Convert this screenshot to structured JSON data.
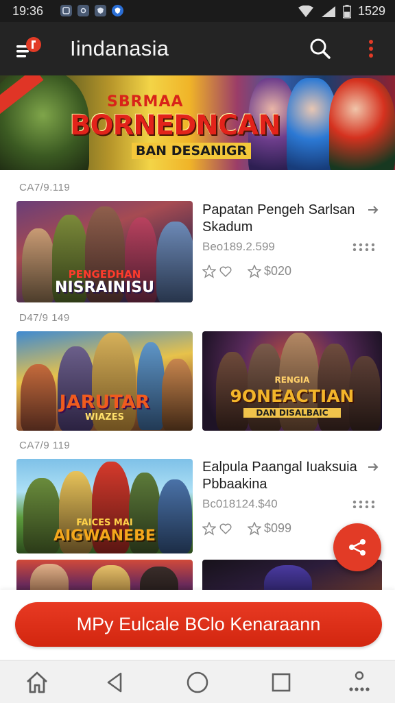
{
  "status_bar": {
    "time": "19:36",
    "clock_right": "1529",
    "icons": [
      "notification-icon",
      "photo-icon",
      "shield-icon",
      "wifi-icon",
      "signal-icon",
      "battery-icon"
    ]
  },
  "app_bar": {
    "title": "Iindanasia",
    "icons": [
      "app-logo-icon",
      "search-icon",
      "more-vert-icon"
    ]
  },
  "banner": {
    "line1": "SBRMAA",
    "line2": "BORNEDNCAN",
    "line3": "BAN DESANIGR"
  },
  "feed": {
    "sections": [
      {
        "category": "CA7/9.119",
        "items": [
          {
            "thumbnail_caption": "NISRAINISU",
            "thumbnail_subcaption": "PENGEDHAN",
            "title": "Papatan Pengeh Sarlsan Skadum",
            "meta": "Beo189.2.599",
            "price": "$020"
          }
        ]
      },
      {
        "category": "D47/9 149",
        "items": [
          {
            "thumbnail_caption": "JARUTAR",
            "thumbnail_subcaption": "WIAZES"
          },
          {
            "thumbnail_caption": "9ONEACTIAN",
            "thumbnail_subcaption": "DAN DISALBAIC",
            "thumbnail_topcaption": "RENGIA"
          }
        ]
      },
      {
        "category": "CA7/9 119",
        "items": [
          {
            "thumbnail_caption": "AIGWANEBE",
            "thumbnail_subcaption": "FAICES MAI",
            "title": "Ealpula Paangal Iuaksuia Pbbaakina",
            "meta": "Bc018124.$40",
            "price": "$099"
          }
        ]
      }
    ]
  },
  "cta_button": {
    "label": "MPy Eulcale BClo Kenaraann"
  },
  "nav_bar": {
    "items": [
      "home-icon",
      "back-icon",
      "home-circle-icon",
      "recents-icon",
      "more-apps-icon"
    ]
  },
  "colors": {
    "accent": "#e23b26",
    "app_bar": "#242424",
    "status_bar": "#1b1b1b"
  }
}
